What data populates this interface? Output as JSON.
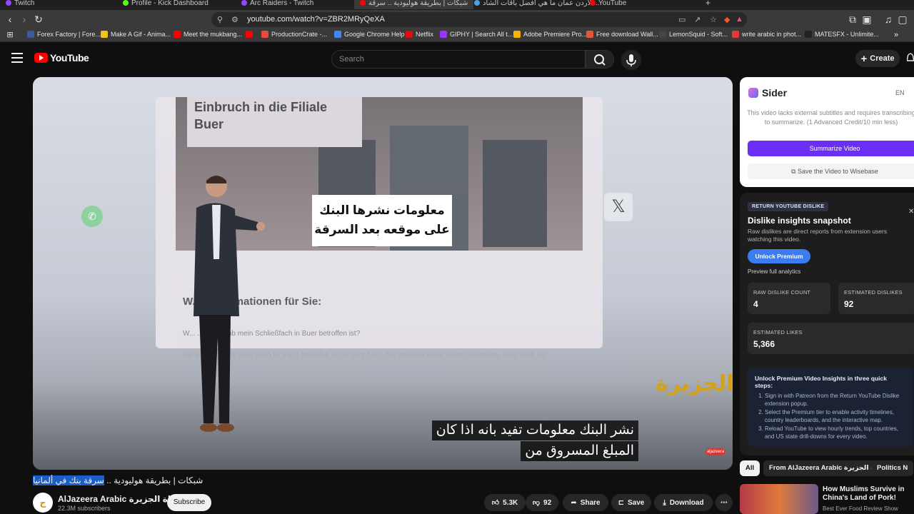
{
  "browser": {
    "tabs": [
      {
        "label": "Twitch",
        "color": "#9146ff",
        "active": false
      },
      {
        "label": "Profile - Kick Dashboard",
        "color": "#53fc18",
        "active": false
      },
      {
        "label": "Arc Raiders - Twitch",
        "color": "#9146ff",
        "active": false
      },
      {
        "label": "شبكات | بطريقة هوليودية .. سرقة",
        "color": "#ff0000",
        "active": true
      },
      {
        "label": "الأردن عمان ما هي أفضل باقات الشاد...",
        "color": "#4aa3df",
        "active": false
      },
      {
        "label": "YouTube",
        "color": "#ff0000",
        "active": false
      }
    ],
    "url": "youtube.com/watch?v=ZBR2MRyQeXA",
    "bookmarks": [
      {
        "label": "Forex Factory | Fore...",
        "color": "#3d5a99"
      },
      {
        "label": "Make A Gif - Anima...",
        "color": "#f0c419"
      },
      {
        "label": "Meet the mukbang...",
        "color": "#ff0000"
      },
      {
        "label": "",
        "color": "#ff0000"
      },
      {
        "label": "ProductionCrate -...",
        "color": "#e84c3d"
      },
      {
        "label": "Google Chrome Help",
        "color": "#4285f4"
      },
      {
        "label": "Netflix",
        "color": "#e50914"
      },
      {
        "label": "GIPHY | Search All t...",
        "color": "#9933ff"
      },
      {
        "label": "Adobe Premiere Pro...",
        "color": "#f4b400"
      },
      {
        "label": "Free download Wall...",
        "color": "#e8553d"
      },
      {
        "label": "LemonSquid - Soft...",
        "color": "#444"
      },
      {
        "label": "write arabic in phot...",
        "color": "#e53935"
      },
      {
        "label": "MATESFX - Unlimite...",
        "color": "#222"
      }
    ]
  },
  "youtube": {
    "logo_text": "YouTube",
    "search_placeholder": "Search",
    "create_label": "Create"
  },
  "video": {
    "screen_heading": "Einbruch in die Filiale Buer",
    "screen_sub": "W... ...nformationen für Sie:",
    "screen_line1": "W... ...stellen, ob mein Schließfach in Buer betroffen ist?",
    "screen_line2": "Die W... ...chkeit, dass auch Ihr Fach betroffen ist, ist sehr hoch. Sie müssen leider davon ausgehen, dass auch Ihr",
    "caption_line1": "معلومات نشرها البنك",
    "caption_line2": "على موقعه بعد السرقة",
    "subtitle_line1": "نشر البنك معلومات تفيد بانه اذا كان",
    "subtitle_line2": "المبلغ المسروق من",
    "x_logo": "𝕏",
    "jazeera_logo": "الجزيرة",
    "live_badge": "aljazeera"
  },
  "watch": {
    "title_plain": "شبكات | بطريقة هوليودية .. ",
    "title_highlight": "سرقة بنك في ألمانيا",
    "channel_name": "AlJazeera Arabic قناة الجزيرة",
    "channel_subs": "22.3M subscribers",
    "subscribe_label": "Subscribe",
    "likes": "5.3K",
    "dislikes": "92",
    "share_label": "Share",
    "save_label": "Save",
    "download_label": "Download"
  },
  "sider": {
    "brand": "Sider",
    "lang": "EN",
    "description": "This video lacks external subtitles and requires transcribing to summarize. (1 Advanced Credit/10 min less)",
    "summarize_label": "Summarize Video",
    "save_label": "Save the Video to Wisebase"
  },
  "ryd": {
    "tag": "RETURN YOUTUBE DISLIKE",
    "heading": "Dislike insights snapshot",
    "description": "Raw dislikes are direct reports from extension users watching this video.",
    "unlock_label": "Unlock Premium",
    "preview_label": "Preview full analytics",
    "raw_dislike_label": "RAW DISLIKE COUNT",
    "raw_dislike_value": "4",
    "est_dislike_label": "ESTIMATED DISLIKES",
    "est_dislike_value": "92",
    "est_likes_label": "ESTIMATED LIKES",
    "est_likes_value": "5,366",
    "steps_title": "Unlock Premium Video Insights in three quick steps:",
    "steps": [
      "Sign in with Patreon from the Return YouTube Dislike extension popup.",
      "Select the Premium tier to enable activity timelines, country leaderboards, and the interactive map.",
      "Reload YouTube to view hourly trends, top countries, and US state drill-downs for every video."
    ]
  },
  "recommendations": {
    "chips": [
      "All",
      "From AlJazeera Arabic قناة الجزيرة",
      "Politics N"
    ],
    "first_title": "How Muslims Survive in China's Land of Pork!",
    "first_channel": "Best Ever Food Review Show"
  }
}
